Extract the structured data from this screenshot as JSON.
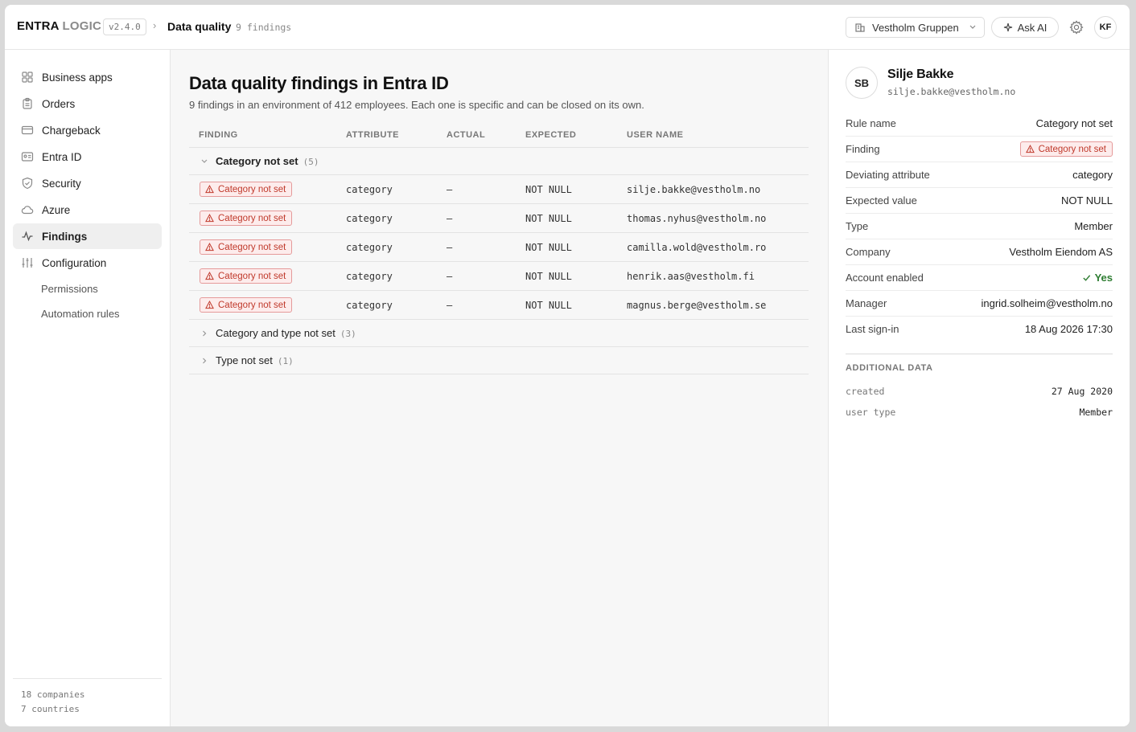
{
  "header": {
    "brand_primary": "ENTRA",
    "brand_secondary": "LOGIC",
    "version": "v2.4.0",
    "breadcrumb_separator": "›",
    "page": "Data quality",
    "findings_count": "9 findings",
    "org_selector": "Vestholm Gruppen",
    "ask_ai": "Ask AI",
    "user_initials": "KF"
  },
  "sidebar": {
    "items": [
      {
        "label": "Business apps",
        "icon": "grid-icon"
      },
      {
        "label": "Orders",
        "icon": "clipboard-icon"
      },
      {
        "label": "Chargeback",
        "icon": "credit-card-icon"
      },
      {
        "label": "Entra ID",
        "icon": "id-card-icon"
      },
      {
        "label": "Security",
        "icon": "shield-icon"
      },
      {
        "label": "Azure",
        "icon": "cloud-icon"
      },
      {
        "label": "Findings",
        "icon": "activity-icon"
      },
      {
        "label": "Configuration",
        "icon": "sliders-icon"
      }
    ],
    "active_item": "Findings",
    "sub_items": [
      "Permissions",
      "Automation rules"
    ],
    "footer": {
      "companies": "18 companies",
      "countries": "7 countries"
    }
  },
  "main": {
    "title": "Data quality findings in Entra ID",
    "subtitle": "9 findings in an environment of 412 employees. Each one is specific and can be closed on its own.",
    "columns": [
      "FINDING",
      "ATTRIBUTE",
      "ACTUAL",
      "EXPECTED",
      "USER NAME"
    ],
    "groups": [
      {
        "label": "Category not set",
        "count": "(5)",
        "expanded": true,
        "rows": [
          {
            "finding": "Category not set",
            "attribute": "category",
            "actual": "—",
            "expected": "NOT NULL",
            "user": "silje.bakke@vestholm.no"
          },
          {
            "finding": "Category not set",
            "attribute": "category",
            "actual": "—",
            "expected": "NOT NULL",
            "user": "thomas.nyhus@vestholm.no"
          },
          {
            "finding": "Category not set",
            "attribute": "category",
            "actual": "—",
            "expected": "NOT NULL",
            "user": "camilla.wold@vestholm.ro"
          },
          {
            "finding": "Category not set",
            "attribute": "category",
            "actual": "—",
            "expected": "NOT NULL",
            "user": "henrik.aas@vestholm.fi"
          },
          {
            "finding": "Category not set",
            "attribute": "category",
            "actual": "—",
            "expected": "NOT NULL",
            "user": "magnus.berge@vestholm.se"
          }
        ]
      },
      {
        "label": "Category and type not set",
        "count": "(3)",
        "expanded": false,
        "rows": []
      },
      {
        "label": "Type not set",
        "count": "(1)",
        "expanded": false,
        "rows": []
      }
    ]
  },
  "detail": {
    "initials": "SB",
    "name": "Silje Bakke",
    "email": "silje.bakke@vestholm.no",
    "fields": [
      {
        "key": "Rule name",
        "value": "Category not set"
      },
      {
        "key": "Finding",
        "value": "Category not set",
        "badge": true
      },
      {
        "key": "Deviating attribute",
        "value": "category"
      },
      {
        "key": "Expected value",
        "value": "NOT NULL"
      },
      {
        "key": "Type",
        "value": "Member"
      },
      {
        "key": "Company",
        "value": "Vestholm Eiendom AS"
      },
      {
        "key": "Account enabled",
        "value": "Yes"
      },
      {
        "key": "Manager",
        "value": "ingrid.solheim@vestholm.no"
      },
      {
        "key": "Last sign-in",
        "value": "18 Aug 2026 17:30"
      }
    ],
    "additional_title": "ADDITIONAL DATA",
    "additional": [
      {
        "key": "created",
        "value": "27 Aug 2020"
      },
      {
        "key": "user type",
        "value": "Member"
      }
    ]
  },
  "colors": {
    "badge_text": "#c0392b",
    "badge_bg": "#fdecec",
    "success": "#2e7d32"
  }
}
